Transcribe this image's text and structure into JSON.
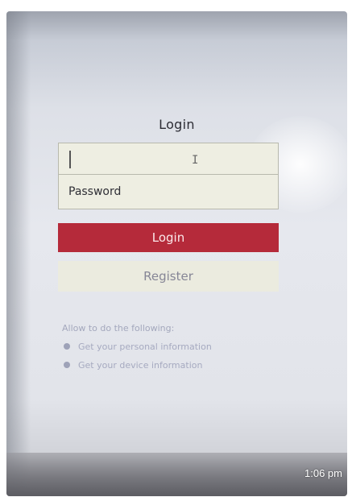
{
  "login_form": {
    "title": "Login",
    "username_value": "",
    "password_placeholder": "Password",
    "login_button": "Login",
    "register_button": "Register"
  },
  "permissions": {
    "heading": "Allow to do the following:",
    "items": [
      "Get your personal information",
      "Get your device information"
    ]
  },
  "timestamp": "1:06 pm",
  "colors": {
    "login_button": "#b52a3a",
    "register_button": "#ebebdf",
    "field_background": "#eeeee2"
  }
}
